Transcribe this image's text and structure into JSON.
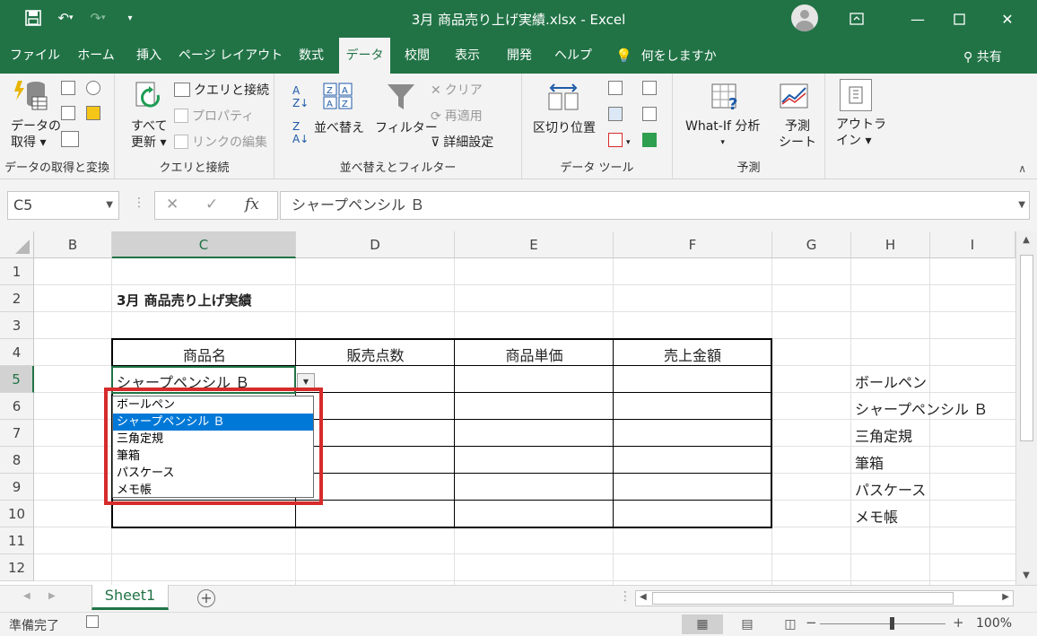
{
  "window": {
    "title": "3月 商品売り上げ実績.xlsx  -  Excel",
    "share": "共有",
    "tell_me": "何をしますか"
  },
  "tabs": [
    "ファイル",
    "ホーム",
    "挿入",
    "ページ レイアウト",
    "数式",
    "データ",
    "校閲",
    "表示",
    "開発",
    "ヘルプ"
  ],
  "active_tab": "データ",
  "ribbon": {
    "get_data": {
      "label": "データの取得・変換",
      "big_button": [
        "データの",
        "取得 ▾"
      ],
      "group": "データの取得と変換"
    },
    "queries": {
      "refresh_all": [
        "すべて",
        "更新 ▾"
      ],
      "queries_connections": "クエリと接続",
      "properties": "プロパティ",
      "edit_links": "リンクの編集",
      "group": "クエリと接続"
    },
    "sort_filter": {
      "sort": "並べ替え",
      "filter": "フィルター",
      "clear": "クリア",
      "reapply": "再適用",
      "advanced": "詳細設定",
      "group": "並べ替えとフィルター"
    },
    "data_tools": {
      "text_to_columns": "区切り位置",
      "group": "データ ツール"
    },
    "forecast": {
      "whatif": [
        "What-If 分析",
        "▾"
      ],
      "forecast_sheet": [
        "予測",
        "シート"
      ],
      "group": "予測"
    },
    "outline": {
      "label": [
        "アウトラ",
        "イン ▾"
      ]
    }
  },
  "formula_bar": {
    "name_box": "C5",
    "content": "シャープペンシル Ｂ"
  },
  "columns": [
    "B",
    "C",
    "D",
    "E",
    "F",
    "G",
    "H",
    "I"
  ],
  "rows": [
    "1",
    "2",
    "3",
    "4",
    "5",
    "6",
    "7",
    "8",
    "9",
    "10",
    "11",
    "12"
  ],
  "sheet": {
    "title": "3月 商品売り上げ実績",
    "headers": [
      "商品名",
      "販売点数",
      "商品単価",
      "売上金額"
    ],
    "c5_value": "シャープペンシル Ｂ",
    "h_list": [
      "ボールペン",
      "シャープペンシル Ｂ",
      "三角定規",
      "筆箱",
      "パスケース",
      "メモ帳"
    ]
  },
  "dropdown": {
    "options": [
      "ボールペン",
      "シャープペンシル Ｂ",
      "三角定規",
      "筆箱",
      "パスケース",
      "メモ帳"
    ],
    "highlighted": 1
  },
  "sheet_tab": "Sheet1",
  "status": {
    "ready": "準備完了",
    "zoom": "100%"
  },
  "colors": {
    "excel_green": "#217346",
    "highlight_blue": "#0078d7",
    "annotation_red": "#d62b2b"
  }
}
